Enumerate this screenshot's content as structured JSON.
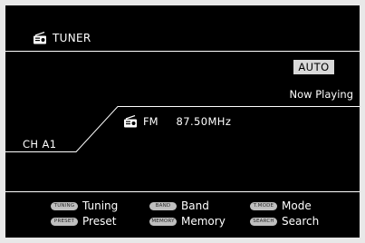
{
  "header": {
    "title": "TUNER",
    "icon": "radio-icon"
  },
  "auto_badge": "AUTO",
  "now_playing": "Now Playing",
  "channel": "CH A1",
  "station": {
    "band": "FM",
    "frequency": "87.50MHz",
    "icon": "radio-icon"
  },
  "legend": [
    {
      "key": "TUNING",
      "label": "Tuning"
    },
    {
      "key": "BAND",
      "label": "Band"
    },
    {
      "key": "T.MODE",
      "label": "Mode"
    },
    {
      "key": "PRESET",
      "label": "Preset"
    },
    {
      "key": "MEMORY",
      "label": "Memory"
    },
    {
      "key": "SEARCH",
      "label": "Search"
    }
  ],
  "colors": {
    "background": "#000000",
    "text": "#ffffff",
    "badge": "#d9d9d9",
    "key_badge": "#bfbfbf"
  }
}
